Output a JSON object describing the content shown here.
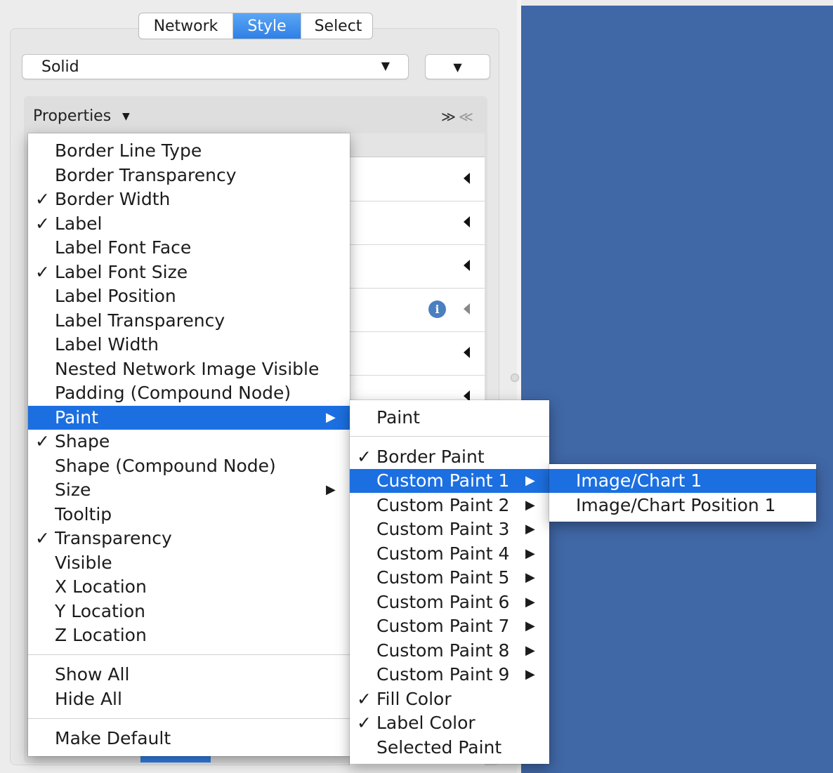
{
  "tabs": [
    {
      "label": "Network",
      "active": false
    },
    {
      "label": "Style",
      "active": true
    },
    {
      "label": "Select",
      "active": false
    }
  ],
  "style_combo": {
    "value": "Solid"
  },
  "properties": {
    "label": "Properties",
    "icons": [
      "double-chevron-down-icon",
      "double-chevron-up-icon"
    ]
  },
  "colors": {
    "accent": "#1c6fe0",
    "canvas": "#4067a6",
    "info": "#4a7fc0"
  },
  "menu1": {
    "items": [
      {
        "label": "Border Line Type",
        "checked": false
      },
      {
        "label": "Border Transparency",
        "checked": false
      },
      {
        "label": "Border Width",
        "checked": true
      },
      {
        "label": "Label",
        "checked": true
      },
      {
        "label": "Label Font Face",
        "checked": false
      },
      {
        "label": "Label Font Size",
        "checked": true
      },
      {
        "label": "Label Position",
        "checked": false
      },
      {
        "label": "Label Transparency",
        "checked": false
      },
      {
        "label": "Label Width",
        "checked": false
      },
      {
        "label": "Nested Network Image Visible",
        "checked": false
      },
      {
        "label": "Padding (Compound Node)",
        "checked": false
      },
      {
        "label": "Paint",
        "checked": false,
        "submenu": true,
        "highlighted": true
      },
      {
        "label": "Shape",
        "checked": true
      },
      {
        "label": "Shape (Compound Node)",
        "checked": false
      },
      {
        "label": "Size",
        "checked": false,
        "submenu": true
      },
      {
        "label": "Tooltip",
        "checked": false
      },
      {
        "label": "Transparency",
        "checked": true
      },
      {
        "label": "Visible",
        "checked": false
      },
      {
        "label": "X Location",
        "checked": false
      },
      {
        "label": "Y Location",
        "checked": false
      },
      {
        "label": "Z Location",
        "checked": false
      }
    ],
    "show_all": "Show All",
    "hide_all": "Hide All",
    "make_default": "Make Default",
    "check_glyph": "✓",
    "arrow_glyph": "▶"
  },
  "menu2": {
    "header": "Paint",
    "items": [
      {
        "label": "Border Paint",
        "checked": true
      },
      {
        "label": "Custom Paint 1",
        "checked": false,
        "submenu": true,
        "highlighted": true
      },
      {
        "label": "Custom Paint 2",
        "checked": false,
        "submenu": true
      },
      {
        "label": "Custom Paint 3",
        "checked": false,
        "submenu": true
      },
      {
        "label": "Custom Paint 4",
        "checked": false,
        "submenu": true
      },
      {
        "label": "Custom Paint 5",
        "checked": false,
        "submenu": true
      },
      {
        "label": "Custom Paint 6",
        "checked": false,
        "submenu": true
      },
      {
        "label": "Custom Paint 7",
        "checked": false,
        "submenu": true
      },
      {
        "label": "Custom Paint 8",
        "checked": false,
        "submenu": true
      },
      {
        "label": "Custom Paint 9",
        "checked": false,
        "submenu": true
      },
      {
        "label": "Fill Color",
        "checked": true
      },
      {
        "label": "Label Color",
        "checked": true
      },
      {
        "label": "Selected Paint",
        "checked": false
      }
    ]
  },
  "menu3": {
    "items": [
      {
        "label": "Image/Chart 1",
        "highlighted": true
      },
      {
        "label": "Image/Chart Position 1",
        "highlighted": false
      }
    ]
  },
  "rows_info_glyph": "i"
}
